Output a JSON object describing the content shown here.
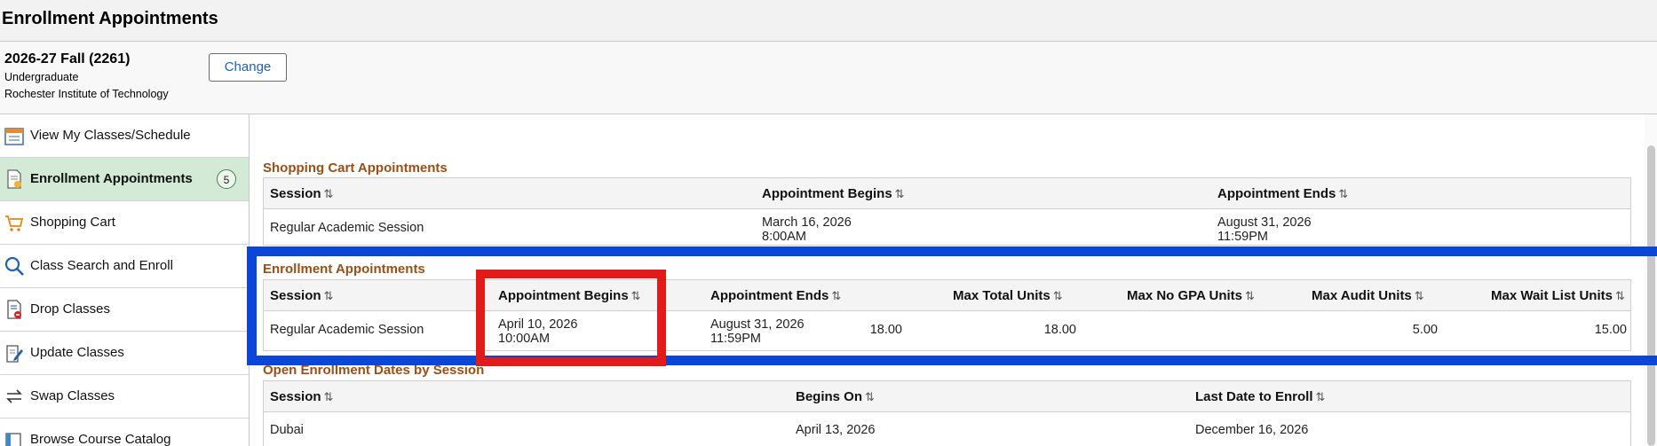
{
  "header": {
    "title": "Enrollment Appointments"
  },
  "term": {
    "name": "2026-27 Fall (2261)",
    "career": "Undergraduate",
    "institution": "Rochester Institute of Technology",
    "change_label": "Change"
  },
  "sidebar": {
    "items": [
      {
        "label": "View My Classes/Schedule",
        "icon": "calendar-icon"
      },
      {
        "label": "Enrollment Appointments",
        "icon": "appointment-document-icon",
        "badge": "5",
        "active": true
      },
      {
        "label": "Shopping Cart",
        "icon": "shopping-cart-icon"
      },
      {
        "label": "Class Search and Enroll",
        "icon": "search-icon"
      },
      {
        "label": "Drop Classes",
        "icon": "drop-document-icon"
      },
      {
        "label": "Update Classes",
        "icon": "edit-document-icon"
      },
      {
        "label": "Swap Classes",
        "icon": "swap-arrows-icon"
      },
      {
        "label": "Browse Course Catalog",
        "icon": "catalog-icon"
      }
    ]
  },
  "sort_glyph": "⇅",
  "shopping_cart": {
    "title": "Shopping Cart Appointments",
    "headers": [
      "Session",
      "Appointment Begins",
      "Appointment Ends"
    ],
    "rows": [
      {
        "session": "Regular Academic Session",
        "begins_date": "March 16, 2026",
        "begins_time": "8:00AM",
        "ends_date": "August 31, 2026",
        "ends_time": "11:59PM"
      }
    ]
  },
  "enrollment": {
    "title": "Enrollment Appointments",
    "headers": [
      "Session",
      "Appointment Begins",
      "Appointment Ends",
      "Max Total Units",
      "Max No GPA Units",
      "Max Audit Units",
      "Max Wait List Units"
    ],
    "rows": [
      {
        "session": "Regular Academic Session",
        "begins_date": "April 10, 2026",
        "begins_time": "10:00AM",
        "ends_date": "August 31, 2026",
        "ends_time": "11:59PM",
        "max_total": "18.00",
        "max_no_gpa": "18.00",
        "max_audit": "5.00",
        "max_wait_list": "15.00"
      }
    ]
  },
  "open_enrollment": {
    "title": "Open Enrollment Dates by Session",
    "headers": [
      "Session",
      "Begins On",
      "Last Date to Enroll"
    ],
    "rows": [
      {
        "session": "Dubai",
        "begins_on": "April 13, 2026",
        "last_date": "December 16, 2026"
      }
    ]
  },
  "colors": {
    "section_title": "#9b4f16",
    "active_nav": "#d3ead6",
    "highlight_blue": "#0a47d6",
    "highlight_red": "#e11a1a",
    "link": "#1f61b8"
  }
}
